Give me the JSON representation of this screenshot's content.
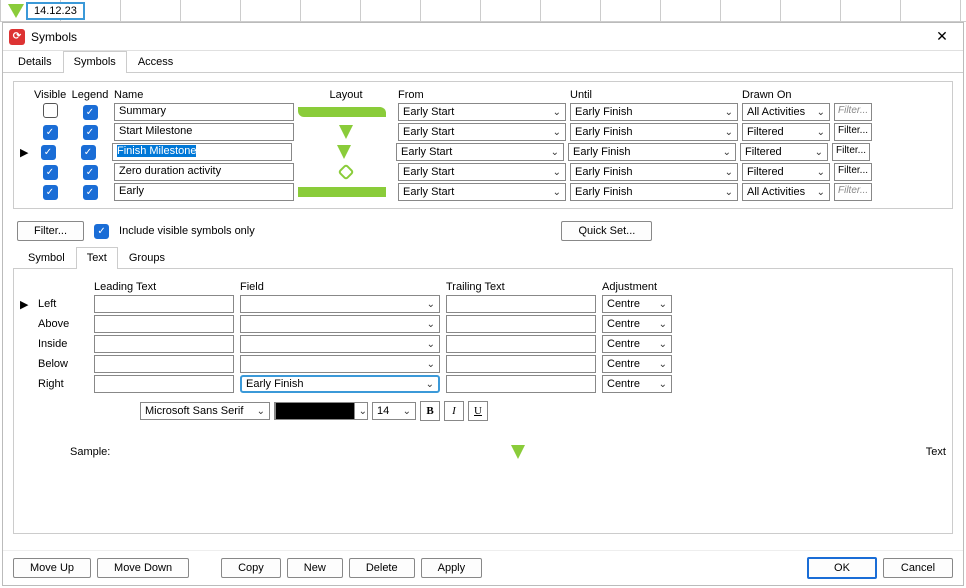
{
  "ruler_date": "14.12.23",
  "window_title": "Symbols",
  "main_tabs": {
    "details": "Details",
    "symbols": "Symbols",
    "access": "Access"
  },
  "grid": {
    "headers": {
      "visible": "Visible",
      "legend": "Legend",
      "name": "Name",
      "layout": "Layout",
      "from": "From",
      "until": "Until",
      "drawn_on": "Drawn On"
    },
    "rows": [
      {
        "visible": false,
        "legend": true,
        "name": "Summary",
        "layout": "bar-taper",
        "from": "Early Start",
        "until": "Early Finish",
        "drawn": "All Activities",
        "filter_enabled": false
      },
      {
        "visible": true,
        "legend": true,
        "name": "Start Milestone",
        "layout": "triangle",
        "from": "Early Start",
        "until": "Early Finish",
        "drawn": "Filtered",
        "filter_enabled": true
      },
      {
        "visible": true,
        "legend": true,
        "name": "Finish Milestone",
        "layout": "triangle",
        "from": "Early Start",
        "until": "Early Finish",
        "drawn": "Filtered",
        "filter_enabled": true,
        "selected": true
      },
      {
        "visible": true,
        "legend": true,
        "name": "Zero duration activity",
        "layout": "diamond",
        "from": "Early Start",
        "until": "Early Finish",
        "drawn": "Filtered",
        "filter_enabled": true
      },
      {
        "visible": true,
        "legend": true,
        "name": "Early",
        "layout": "bar-rect",
        "from": "Early Start",
        "until": "Early Finish",
        "drawn": "All Activities",
        "filter_enabled": false
      }
    ],
    "filter_label": "Filter..."
  },
  "filter_row": {
    "button": "Filter...",
    "include_visible": "Include visible symbols only",
    "quick_set": "Quick Set..."
  },
  "sub_tabs": {
    "symbol": "Symbol",
    "text": "Text",
    "groups": "Groups"
  },
  "text_panel": {
    "headers": {
      "leading": "Leading Text",
      "field": "Field",
      "trailing": "Trailing Text",
      "adjustment": "Adjustment"
    },
    "rows": {
      "left": {
        "label": "Left",
        "field": "",
        "adj": "Centre"
      },
      "above": {
        "label": "Above",
        "field": "",
        "adj": "Centre"
      },
      "inside": {
        "label": "Inside",
        "field": "",
        "adj": "Centre"
      },
      "below": {
        "label": "Below",
        "field": "",
        "adj": "Centre"
      },
      "right": {
        "label": "Right",
        "field": "Early Finish",
        "adj": "Centre"
      }
    }
  },
  "font": {
    "name": "Microsoft Sans Serif",
    "size": "14"
  },
  "sample": {
    "label": "Sample:",
    "text": "Text"
  },
  "bottom": {
    "move_up": "Move Up",
    "move_down": "Move Down",
    "copy": "Copy",
    "new": "New",
    "delete": "Delete",
    "apply": "Apply",
    "ok": "OK",
    "cancel": "Cancel"
  }
}
